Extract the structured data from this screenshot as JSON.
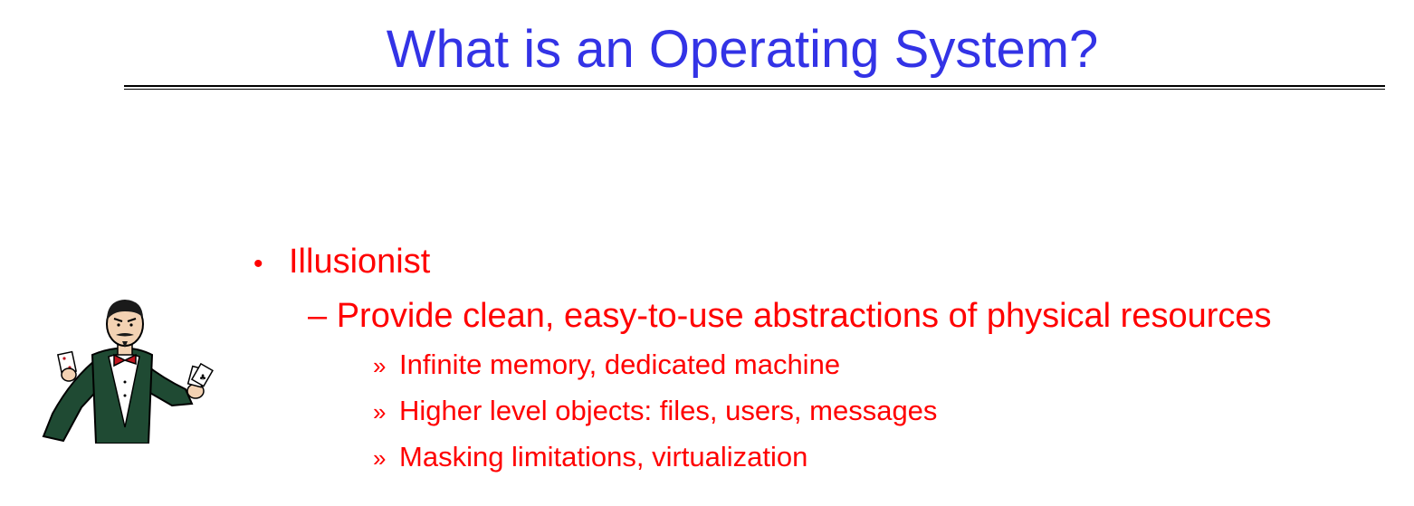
{
  "slide": {
    "title": "What is an Operating System?"
  },
  "content": {
    "bullet": {
      "marker": "•",
      "text": "Illusionist"
    },
    "sub_bullet": {
      "text": "– Provide clean, easy-to-use abstractions of physical resources"
    },
    "sub_sub_bullets": [
      {
        "marker": "»",
        "text": "Infinite memory, dedicated machine"
      },
      {
        "marker": "»",
        "text": "Higher level objects: files, users, messages"
      },
      {
        "marker": "»",
        "text": "Masking limitations, virtualization"
      }
    ]
  },
  "colors": {
    "title": "#3333e6",
    "body_text": "#ff0000",
    "rule": "#000000"
  },
  "illustration": {
    "icon": "magician-with-cards-icon"
  }
}
